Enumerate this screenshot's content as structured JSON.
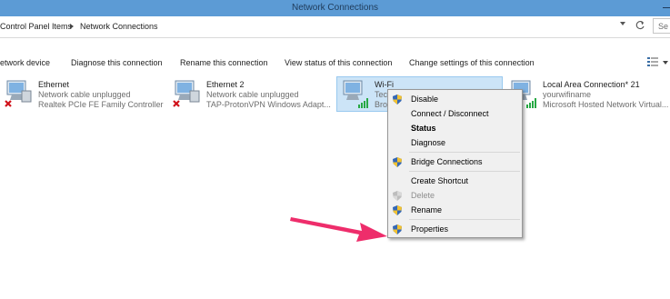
{
  "window": {
    "title": "Network Connections"
  },
  "address": {
    "crumbs": [
      "Control Panel Items",
      "Network Connections"
    ],
    "search_placeholder": "Se"
  },
  "toolbar": {
    "items": [
      "etwork device",
      "Diagnose this connection",
      "Rename this connection",
      "View status of this connection",
      "Change settings of this connection"
    ]
  },
  "connections": [
    {
      "name": "Ethernet",
      "status": "Network cable unplugged",
      "adapter": "Realtek PCIe FE Family Controller",
      "state": "disconnected"
    },
    {
      "name": "Ethernet 2",
      "status": "Network cable unplugged",
      "adapter": "TAP-ProtonVPN Windows Adapt...",
      "state": "disconnected"
    },
    {
      "name": "Wi-Fi",
      "status": "Tec",
      "adapter": "Bro",
      "state": "connected",
      "selected": true
    },
    {
      "name": "Local Area Connection* 21",
      "status": "yourwifiname",
      "adapter": "Microsoft Hosted Network Virtual...",
      "state": "connected"
    }
  ],
  "context_menu": {
    "items": [
      {
        "label": "Disable",
        "shield": true
      },
      {
        "label": "Connect / Disconnect",
        "shield": false
      },
      {
        "label": "Status",
        "shield": false,
        "bold": true
      },
      {
        "label": "Diagnose",
        "shield": false
      },
      {
        "label": "Bridge Connections",
        "shield": true
      },
      {
        "label": "Create Shortcut",
        "shield": false
      },
      {
        "label": "Delete",
        "shield": true,
        "disabled": true
      },
      {
        "label": "Rename",
        "shield": true
      },
      {
        "label": "Properties",
        "shield": true
      }
    ]
  },
  "colors": {
    "titlebar": "#5c9bd5",
    "selection": "#cce4f7",
    "arrow": "#ee2d6b",
    "signal": "#27a844",
    "error": "#d0121b"
  }
}
